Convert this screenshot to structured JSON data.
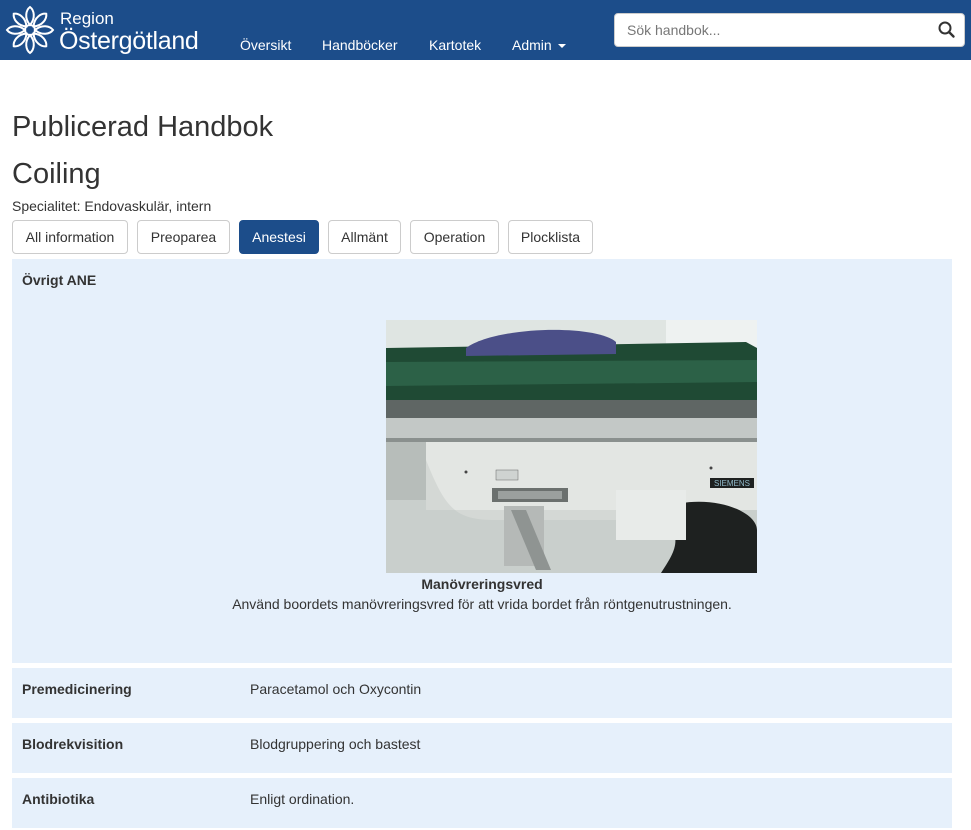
{
  "navbar": {
    "brand_region": "Region",
    "brand_name": "Östergötland",
    "links": [
      "Översikt",
      "Handböcker",
      "Kartotek",
      "Admin"
    ],
    "search_placeholder": "Sök handbok...",
    "color": "#1c4d8a"
  },
  "page": {
    "title": "Publicerad Handbok",
    "subtitle": "Coiling",
    "specialty": "Specialitet: Endovaskulär, intern"
  },
  "tabs": [
    {
      "label": "All information",
      "active": false
    },
    {
      "label": "Preoparea",
      "active": false
    },
    {
      "label": "Anestesi",
      "active": true
    },
    {
      "label": "Allmänt",
      "active": false
    },
    {
      "label": "Operation",
      "active": false
    },
    {
      "label": "Plocklista",
      "active": false
    }
  ],
  "sections": {
    "ovrigt": {
      "label": "Övrigt ANE",
      "image_caption_title": "Manövreringsvred",
      "image_caption_text": "Använd boordets manövreringsvred för att vrida bordet från röntgenutrustningen.",
      "image_brand": "SIEMENS"
    },
    "rows": [
      {
        "label": "Premedicinering",
        "value": "Paracetamol och Oxycontin"
      },
      {
        "label": "Blodrekvisition",
        "value": "Blodgruppering och bastest"
      },
      {
        "label": "Antibiotika",
        "value": "Enligt ordination."
      }
    ]
  },
  "icons": {
    "logo": "snowflake-flower-logo-icon",
    "search": "search-icon",
    "caret": "caret-down-icon"
  }
}
